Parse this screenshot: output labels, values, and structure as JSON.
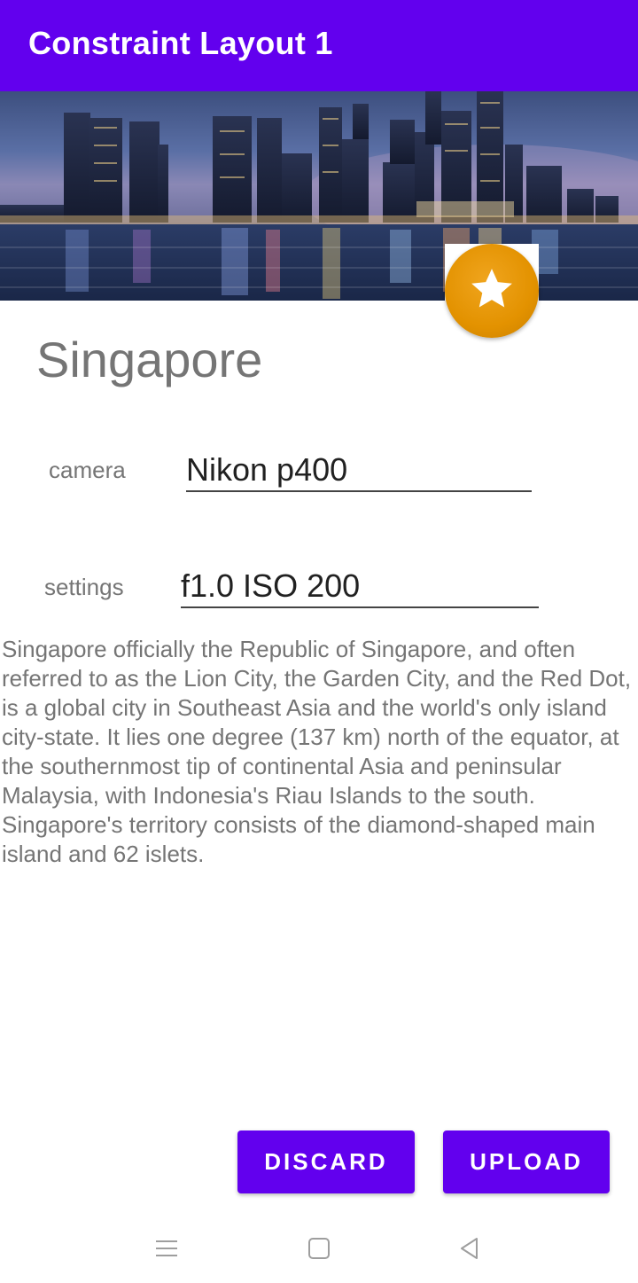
{
  "app_bar": {
    "title": "Constraint Layout 1",
    "color": "#6200ee"
  },
  "hero": {
    "image": "singapore-skyline-night",
    "favorite_icon": "star-icon",
    "favorite_color": "#e39200"
  },
  "main": {
    "title": "Singapore",
    "fields": [
      {
        "label": "camera",
        "value": "Nikon p400"
      },
      {
        "label": "settings",
        "value": "f1.0 ISO 200"
      }
    ],
    "description": "Singapore officially the Republic of Singapore, and often referred to as the Lion City, the Garden City, and the Red Dot, is a global city in Southeast Asia and the world's only island city-state. It lies one degree (137 km) north of the equator, at the southernmost tip of continental Asia and peninsular Malaysia, with Indonesia's Riau Islands to the south. Singapore's territory consists of the diamond-shaped main island and 62 islets."
  },
  "actions": {
    "discard_label": "DISCARD",
    "upload_label": "UPLOAD"
  },
  "nav": {
    "menu_icon": "menu-icon",
    "home_icon": "home-square-icon",
    "back_icon": "back-triangle-icon"
  }
}
